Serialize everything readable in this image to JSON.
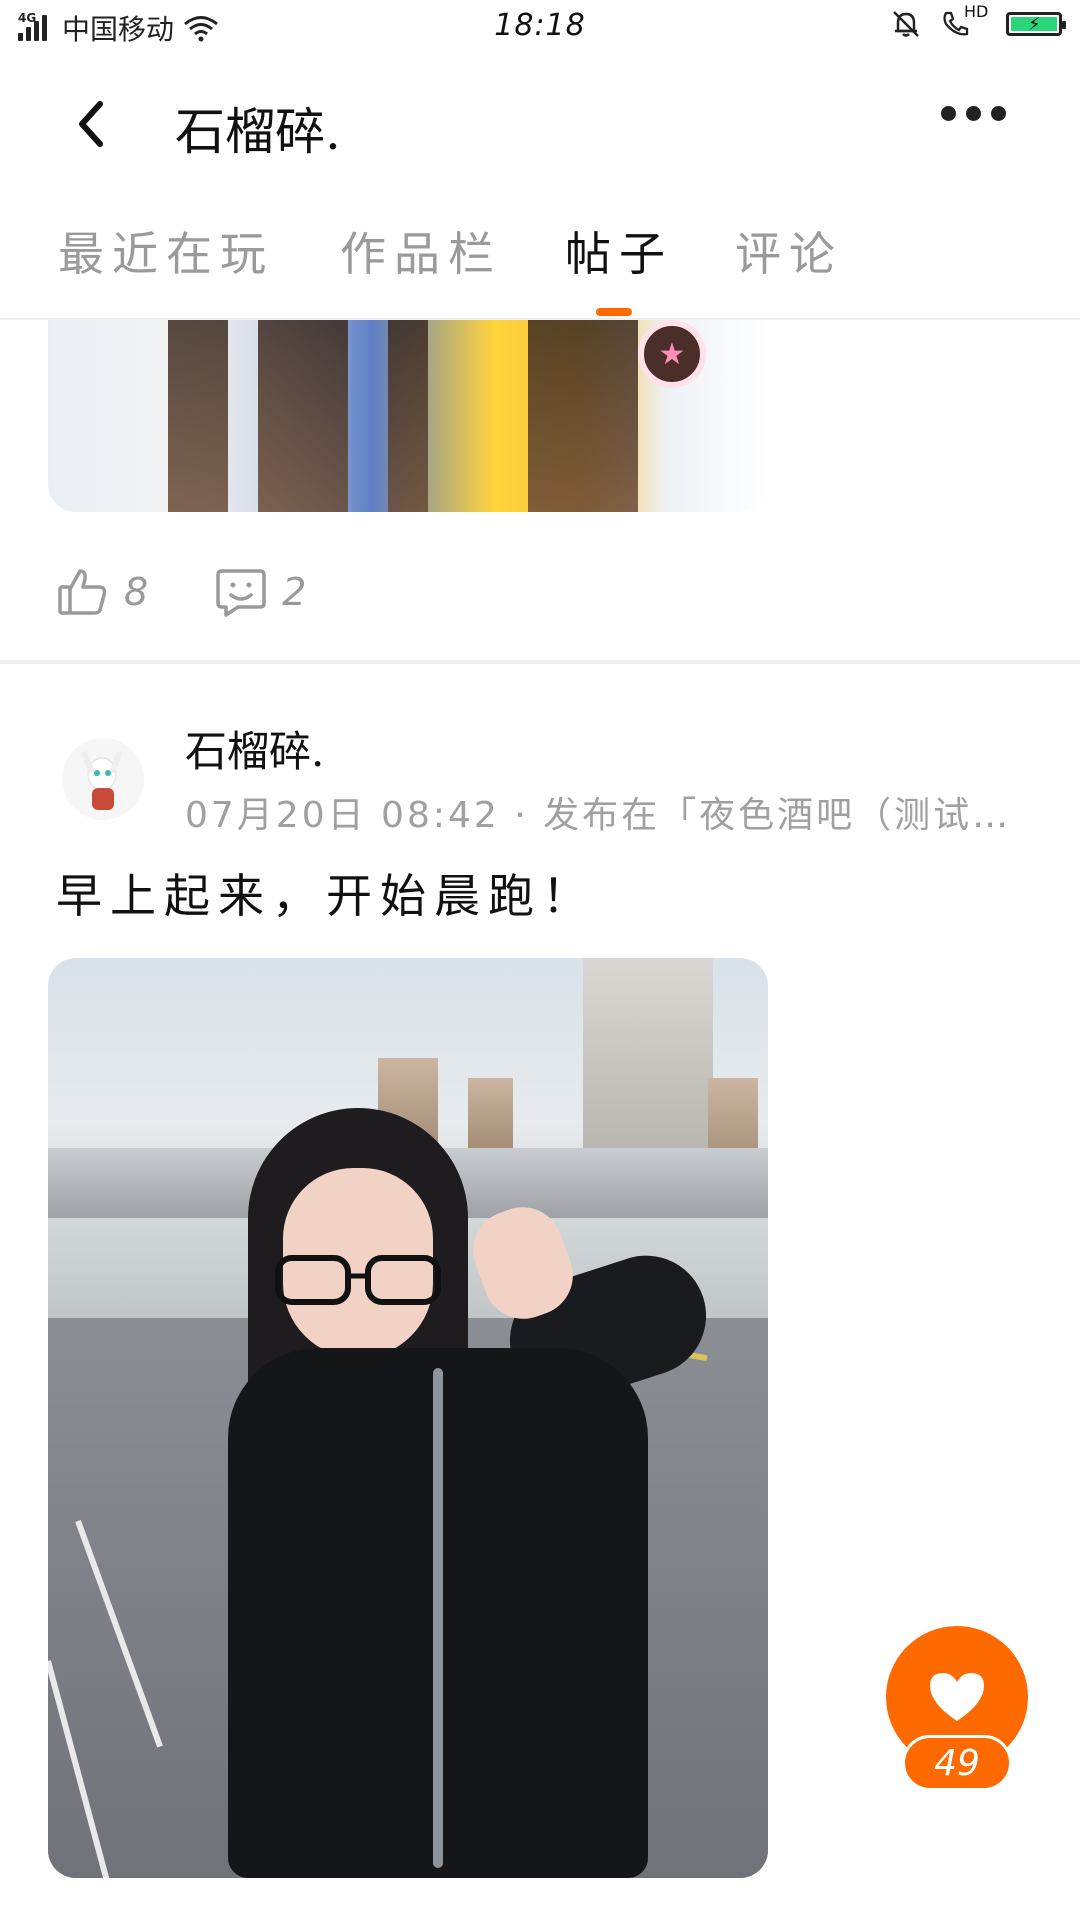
{
  "status_bar": {
    "network_type": "4G",
    "carrier": "中国移动",
    "time": "18:18",
    "hd_label": "HD"
  },
  "header": {
    "title": "石榴碎."
  },
  "tabs": [
    {
      "label": "最近在玩",
      "active": false
    },
    {
      "label": "作品栏",
      "active": false
    },
    {
      "label": "帖子",
      "active": true
    },
    {
      "label": "评论",
      "active": false
    }
  ],
  "posts": [
    {
      "likes": "8",
      "comments": "2"
    },
    {
      "author": "石榴碎.",
      "meta": "07月20日 08:42 · 发布在「夜色酒吧（测试…",
      "text": "早上起来，开始晨跑！"
    }
  ],
  "like_fab": {
    "count": "49"
  },
  "colors": {
    "accent": "#ff6a00",
    "inactive_tab": "#9a9a9a",
    "meta_text": "#a0a0a0"
  },
  "icons": [
    "signal-icon",
    "wifi-icon",
    "silent-bell-icon",
    "hd-call-icon",
    "battery-icon",
    "back-icon",
    "more-icon",
    "thumbs-up-icon",
    "comment-icon",
    "heart-icon"
  ]
}
